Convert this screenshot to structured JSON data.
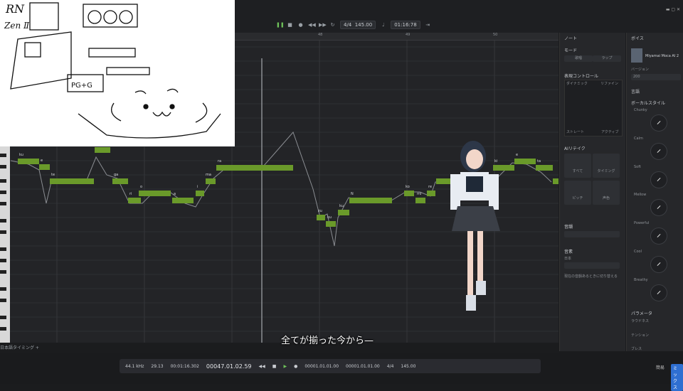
{
  "transport": {
    "time_signature": "4/4",
    "tempo": "145.00",
    "clock": "01:16:78"
  },
  "ruler": {
    "marks": [
      "48",
      "49",
      "50"
    ]
  },
  "note_panel": {
    "title": "ノート",
    "mode_label": "モード",
    "mode_options": [
      "歌唱",
      "ラップ"
    ],
    "expression_label": "表現コントロール",
    "expression_corners": [
      "ダイナミック",
      "リファイン",
      "ストレート",
      "アクティブ"
    ],
    "ai_retake_label": "AIリテイク",
    "ai_retake_buttons": [
      "すべて",
      "タイミング",
      "ピッチ",
      "声色"
    ],
    "phoneme_label": "音韻",
    "vibrato_label": "音素",
    "lyric_label": "日本",
    "checkbox_label": "現在の音韻あるときに切り替える"
  },
  "voice_panel": {
    "title": "ボイス",
    "singer_name": "Miyamai Moca AI 2",
    "version_label": "バージョン",
    "version_value": "200",
    "language_label": "言語",
    "vocal_style_label": "ボーカルスタイル",
    "styles": [
      "Chunky",
      "Calm",
      "Soft",
      "Mellow",
      "Powerful",
      "Cool",
      "Breathy"
    ],
    "params_label": "パラメータ",
    "params": [
      "ラウドネス",
      "テンション",
      "ブレス"
    ]
  },
  "track": {
    "name": "日本語タイミング"
  },
  "bottom": {
    "sample_rate": "44.1 kHz",
    "bpm_value": "29.13",
    "position": "00047.01.02.59",
    "elapsed": "00:01:16.302",
    "loop_start": "00001.01.01.00",
    "loop_end": "00001.01.01.00",
    "meter": "4/4",
    "tempo": "145.00",
    "btn_a": "簡易",
    "btn_b": "ミックス"
  },
  "lyrics": [
    "ku",
    "e",
    "te",
    "ga",
    "ri",
    "o",
    "a",
    "i",
    "ma",
    "ka",
    "ra",
    "zu",
    "ku",
    "ko",
    "te",
    "ku",
    "N",
    "ko",
    "mi",
    "re",
    "ki",
    "e",
    "ta",
    "ko"
  ],
  "subtitle": "全てが揃った今から—",
  "colors": {
    "note": "#6a9a2a",
    "accent": "#2f6fd1",
    "bg": "#232427"
  }
}
